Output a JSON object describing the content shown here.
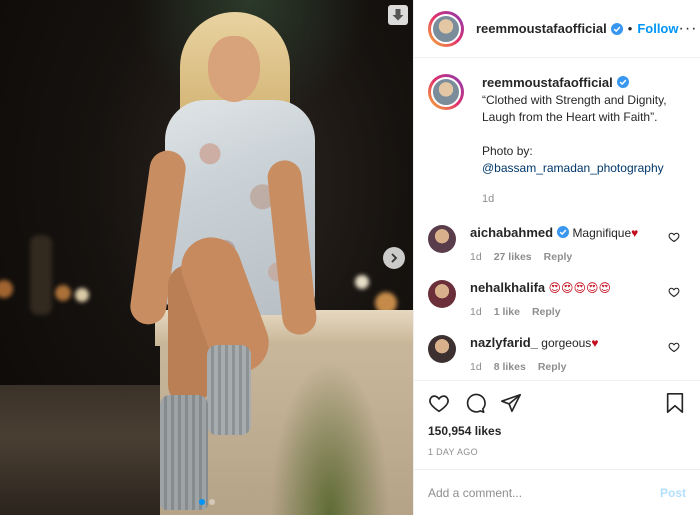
{
  "account": {
    "username": "reemmoustafaofficial",
    "follow_label": "Follow",
    "separator": "•"
  },
  "caption": {
    "username": "reemmoustafaofficial",
    "text": " “Clothed with Strength and Dignity, Laugh from the Heart with Faith”.",
    "photo_by": "Photo by:",
    "mention": "@bassam_ramadan_photography",
    "age": "1d"
  },
  "comments": [
    {
      "username": "aichabahmed",
      "text": "Magnifique",
      "emoji": "♥",
      "age": "1d",
      "likes": "27 likes",
      "reply": "Reply",
      "verified": true,
      "avatar_color": "#5a3d4a"
    },
    {
      "username": "nehalkhalifa",
      "text": "",
      "emoji": "😍😍😍😍😍",
      "age": "1d",
      "likes": "1 like",
      "reply": "Reply",
      "verified": false,
      "avatar_color": "#6b2f3a"
    },
    {
      "username": "nazlyfarid_",
      "text": "gorgeous",
      "emoji": "♥",
      "age": "1d",
      "likes": "8 likes",
      "reply": "Reply",
      "verified": false,
      "avatar_color": "#3d3030"
    }
  ],
  "stats": {
    "likes": "150,954 likes",
    "timestamp": "1 DAY AGO"
  },
  "add_comment": {
    "placeholder": "Add a comment...",
    "post_label": "Post"
  },
  "icons": {
    "verified": "verified-badge-icon",
    "heart": "heart-icon",
    "comment": "comment-icon",
    "share": "share-icon",
    "bookmark": "bookmark-icon",
    "download": "download-icon",
    "next": "chevron-right-icon"
  },
  "colors": {
    "accent": "#0095f6",
    "verified": "#3897f0",
    "post_disabled": "#b2dffc",
    "muted": "#8e8e8e"
  },
  "carousel": {
    "slide_count": 2,
    "active_index": 0
  }
}
